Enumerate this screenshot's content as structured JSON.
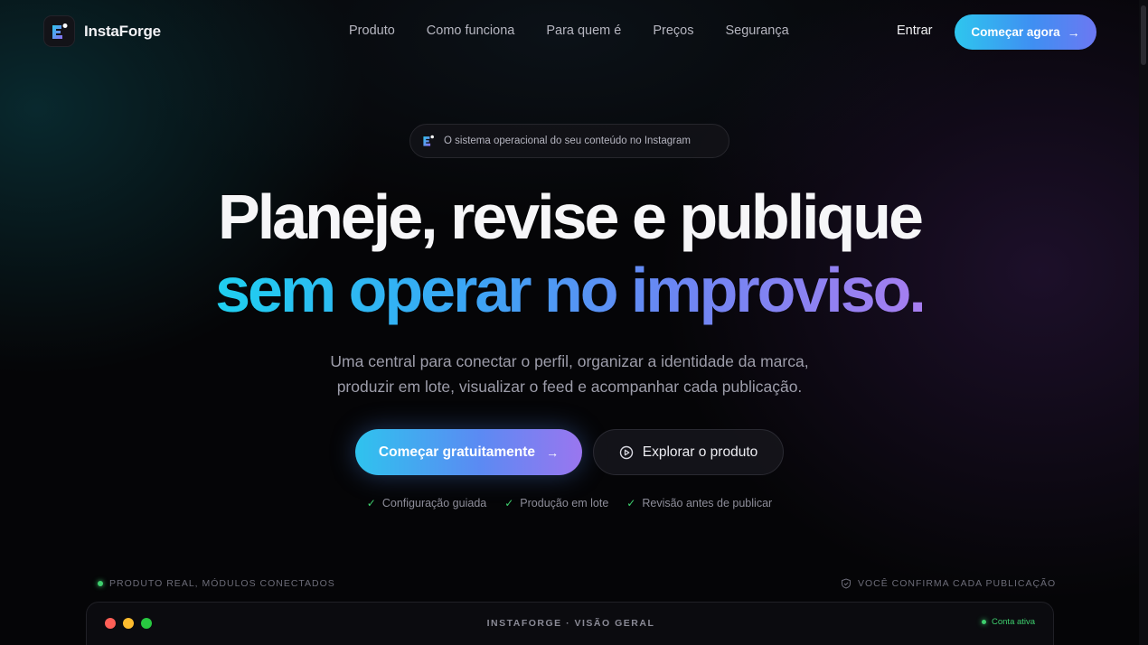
{
  "brand": {
    "name": "InstaForge"
  },
  "nav": {
    "links": [
      "Produto",
      "Como funciona",
      "Para quem é",
      "Preços",
      "Segurança"
    ],
    "login_label": "Entrar",
    "cta_label": "Começar agora"
  },
  "hero": {
    "badge_text": "O sistema operacional do seu conteúdo no Instagram",
    "title_line1": "Planeje, revise e publique",
    "title_line2": "sem operar no improviso.",
    "subtitle_line1": "Uma central para conectar o perfil, organizar a identidade da marca,",
    "subtitle_line2": "produzir em lote, visualizar o feed e acompanhar cada publicação.",
    "primary_cta": "Começar gratuitamente",
    "secondary_cta": "Explorar o produto",
    "checks": [
      "Configuração guiada",
      "Produção em lote",
      "Revisão antes de publicar"
    ]
  },
  "preview": {
    "left_label": "PRODUTO REAL, MÓDULOS CONECTADOS",
    "right_label": "VOCÊ CONFIRMA CADA PUBLICAÇÃO",
    "window_title": "INSTAFORGE · VISÃO GERAL",
    "status_label": "Conta ativa"
  },
  "colors": {
    "background": "#050507",
    "accent_cyan": "#2ec6ee",
    "accent_blue": "#4a8cf2",
    "accent_violet": "#a77ef0",
    "success": "#3ecf6e",
    "traffic_red": "#ff5f57",
    "traffic_yellow": "#febc2e",
    "traffic_green": "#28c840"
  },
  "icons": {
    "brand": "instaforge-logo-icon",
    "arrow": "arrow-right-icon",
    "play": "play-circle-icon",
    "check": "check-icon",
    "shield": "shield-check-icon"
  }
}
